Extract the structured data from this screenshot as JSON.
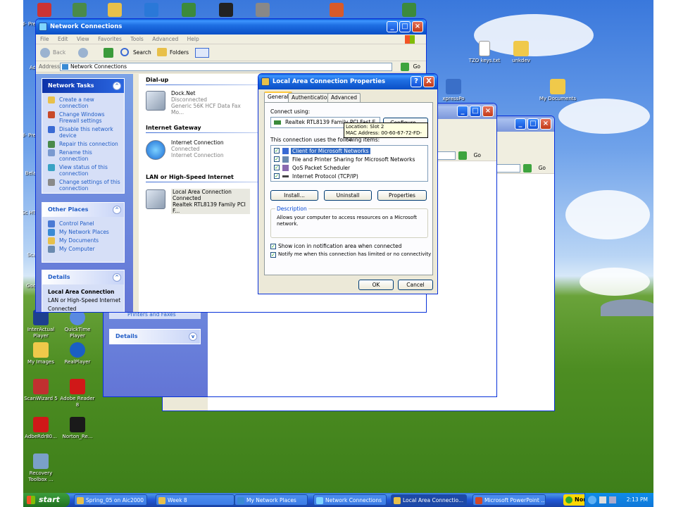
{
  "desktop": {
    "icons_left": [
      {
        "label": "Ad-\nPre"
      },
      {
        "label": "Ad"
      },
      {
        "label": "Ad-\nPre"
      },
      {
        "label": "Bela"
      },
      {
        "label": "Sc\nHT"
      },
      {
        "label": "Sca"
      },
      {
        "label": "Goo"
      }
    ],
    "icons": {
      "interactual": "InterActual\nPlayer",
      "quicktime": "QuickTime\nPlayer",
      "my_images": "My Images",
      "realplayer": "RealPlayer",
      "scanwizard": "ScanWizard 5",
      "adobe_reader": "Adobe Reader\n8",
      "adberdr": "AdbeRdr80...",
      "norton_re": "Norton_Re...",
      "recovery": "Recovery\nToolbox ...",
      "tzo_keys": "TZO keys.txt",
      "unkdev": "unkdev",
      "my_documents": "My Documents",
      "express_partial": "xpressPo"
    }
  },
  "explorer": {
    "title": "Network Connections",
    "menu": [
      "File",
      "Edit",
      "View",
      "Favorites",
      "Tools",
      "Advanced",
      "Help"
    ],
    "toolbar": {
      "back": "Back",
      "search": "Search",
      "folders": "Folders"
    },
    "address_label": "Address",
    "address_value": "Network Connections",
    "go": "Go",
    "network_tasks": {
      "title": "Network Tasks",
      "items": [
        "Create a new connection",
        "Change Windows Firewall settings",
        "Disable this network device",
        "Repair this connection",
        "Rename this connection",
        "View status of this connection",
        "Change settings of this connection"
      ]
    },
    "other_places": {
      "title": "Other Places",
      "items": [
        "Control Panel",
        "My Network Places",
        "My Documents",
        "My Computer"
      ]
    },
    "details": {
      "title": "Details",
      "name": "Local Area Connection",
      "type": "LAN or High-Speed Internet",
      "status": "Connected"
    },
    "groups": {
      "dialup": "Dial-up",
      "gateway": "Internet Gateway",
      "lan": "LAN or High-Speed Internet"
    },
    "connections": {
      "dock": {
        "name": "Dock.Net",
        "status": "Disconnected",
        "device": "Generic 56K HCF Data Fax Mo..."
      },
      "gateway": {
        "name": "Internet Connection",
        "status": "Connected",
        "device": "Internet Connection"
      },
      "lan": {
        "name": "Local Area Connection",
        "status": "Connected",
        "device": "Realtek RTL8139 Family PCI F..."
      }
    }
  },
  "back_windows": {
    "printers_faxes": "Printers and Faxes",
    "details": "Details",
    "go": "Go"
  },
  "dialog": {
    "title": "Local Area Connection Properties",
    "tabs": [
      "General",
      "Authentication",
      "Advanced"
    ],
    "connect_using_label": "Connect using:",
    "adapter": "Realtek RTL8139 Family PCI Fast E...",
    "configure": "Configure...",
    "tooltip_line1": "Location: Slot 2",
    "tooltip_line2": "MAC Address: 00-60-67-72-FD-F2",
    "items_label": "This connection uses the following items:",
    "items": [
      {
        "label": "Client for Microsoft Networks",
        "checked": true
      },
      {
        "label": "File and Printer Sharing for Microsoft Networks",
        "checked": true
      },
      {
        "label": "QoS Packet Scheduler",
        "checked": true
      },
      {
        "label": "Internet Protocol (TCP/IP)",
        "checked": true
      }
    ],
    "install": "Install...",
    "uninstall": "Uninstall",
    "properties": "Properties",
    "description_title": "Description",
    "description": "Allows your computer to access resources on a Microsoft network.",
    "show_icon": "Show icon in notification area when connected",
    "notify": "Notify me when this connection has limited or no connectivity",
    "ok": "OK",
    "cancel": "Cancel",
    "help_btn": "?",
    "close_btn": "X"
  },
  "taskbar": {
    "start": "start",
    "buttons": [
      "Spring_05 on Aic2000",
      "Week 8",
      "My Network Places",
      "Network Connections",
      "Local Area Connectio...",
      "Microsoft PowerPoint ..."
    ],
    "norton": "Norton",
    "time": "2:13 PM"
  }
}
